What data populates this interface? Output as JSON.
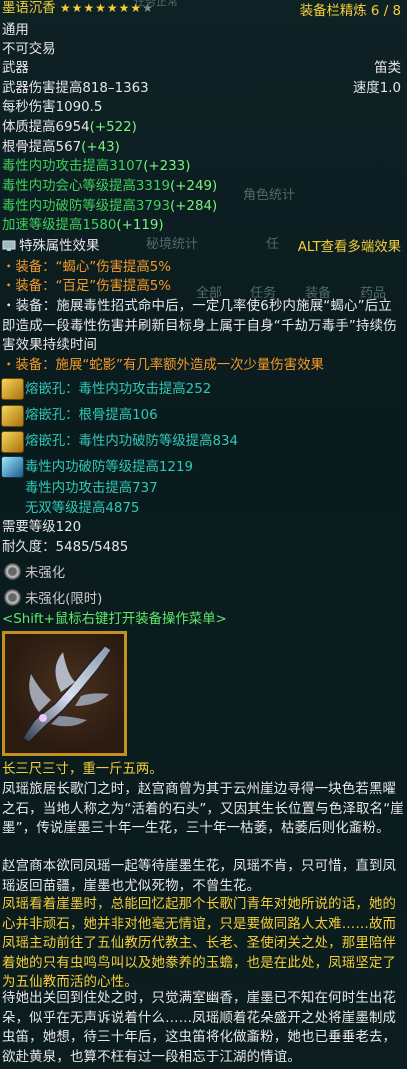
{
  "header": {
    "item_name": "墨语沉香",
    "stars": 8,
    "stars_filled": 7,
    "ghost_tag": "任务正常",
    "refine_label": "装备栏精炼 6 / 8"
  },
  "binding": {
    "type": "通用",
    "trade": "不可交易"
  },
  "item_type": {
    "category": "武器",
    "subtype": "笛类"
  },
  "stats": {
    "damage": "武器伤害提高818–1363",
    "speed": "速度1.0",
    "dps": "每秒伤害1090.5",
    "constitution": {
      "base": "体质提高6954",
      "bonus": "(+522)"
    },
    "bone": {
      "base": "根骨提高567",
      "bonus": "(+43)"
    },
    "poison_attack": {
      "base": "毒性内功攻击提高3107",
      "bonus": "(+233)"
    },
    "poison_crit": {
      "base": "毒性内功会心等级提高3319",
      "bonus": "(+249)"
    },
    "poison_pierce": {
      "base": "毒性内功破防等级提高3793",
      "bonus": "(+284)"
    },
    "haste": {
      "base": "加速等级提高1580",
      "bonus": "(+119)"
    }
  },
  "ghost_ui": {
    "role_stats": "角色统计",
    "secret_stats": "秘境统计",
    "ren": "任",
    "all": "全部",
    "task": "任务",
    "equip": "装备",
    "medicine": "药品"
  },
  "special": {
    "title": "特殊属性效果",
    "alt_hint": "ALT查看多端效果",
    "effects": [
      "・装备：“蝎心”伤害提高5%",
      "・装备：“百足”伤害提高5%",
      "・装备：施展毒性招式命中后，一定几率使6秒内施展“蝎心”后立即造成一段毒性伤害并刷新目标身上属于自身“千劫万毒手”持续伤害效果持续时间",
      "・装备：施展“蛇影”有几率额外造成一次少量伤害效果"
    ]
  },
  "sockets": [
    "熔嵌孔：毒性内功攻击提高252",
    "熔嵌孔：根骨提高106",
    "熔嵌孔：毒性内功破防等级提高834"
  ],
  "enchant": {
    "line1": "毒性内功破防等级提高1219",
    "line2": "毒性内功攻击提高737",
    "line3": "无双等级提高4875"
  },
  "requirements": {
    "level": "需要等级120",
    "durability": "耐久度：5485/5485"
  },
  "strengthen": {
    "slot1": "未强化",
    "slot2": "未强化(限时)"
  },
  "hint": "<Shift+鼠标右键打开装备操作菜单>",
  "description": {
    "size": "长三尺三寸，重一斤五两。",
    "p1": "凤瑶旅居长歌门之时，赵宫商曾为其于云州崖边寻得一块色若黑曜之石，当地人称之为“活着的石头”，又因其生长位置与色泽取名“崖墨”，传说崖墨三十年一生花，三十年一枯萎，枯萎后则化齑粉。",
    "p2": "赵宫商本欲同凤瑶一起等待崖墨生花，凤瑶不肯，只可惜，直到凤瑶返回苗疆，崖墨也尤似死物，不曾生花。",
    "p3": "凤瑶看着崖墨时，总能回忆起那个长歌门青年对她所说的话，她的心并非顽石，她并非对他毫无情谊，只是要做同路人太难……故而凤瑶主动前往了五仙教历代教主、长老、圣使闭关之处，那里陪伴着她的只有虫鸣鸟叫以及她豢养的玉蟾，也是在此处，凤瑶坚定了为五仙教而活的心性。",
    "p4": "待她出关回到住处之时，只觉满室幽香，崖墨已不知在何时生出花朵，似乎在无声诉说着什么……凤瑶顺着花朵盛开之处将崖墨制成虫笛，她想，待三十年后，这虫笛将化做齑粉，她也已垂垂老去，欲赴黄泉，也算不枉有过一段相忘于江湖的情谊。"
  },
  "colors": {
    "gold": "#f4cf3a",
    "green": "#3fd15b",
    "orange": "#f39a2a",
    "teal": "#2fc8b5",
    "background": "#0a1a1c"
  }
}
